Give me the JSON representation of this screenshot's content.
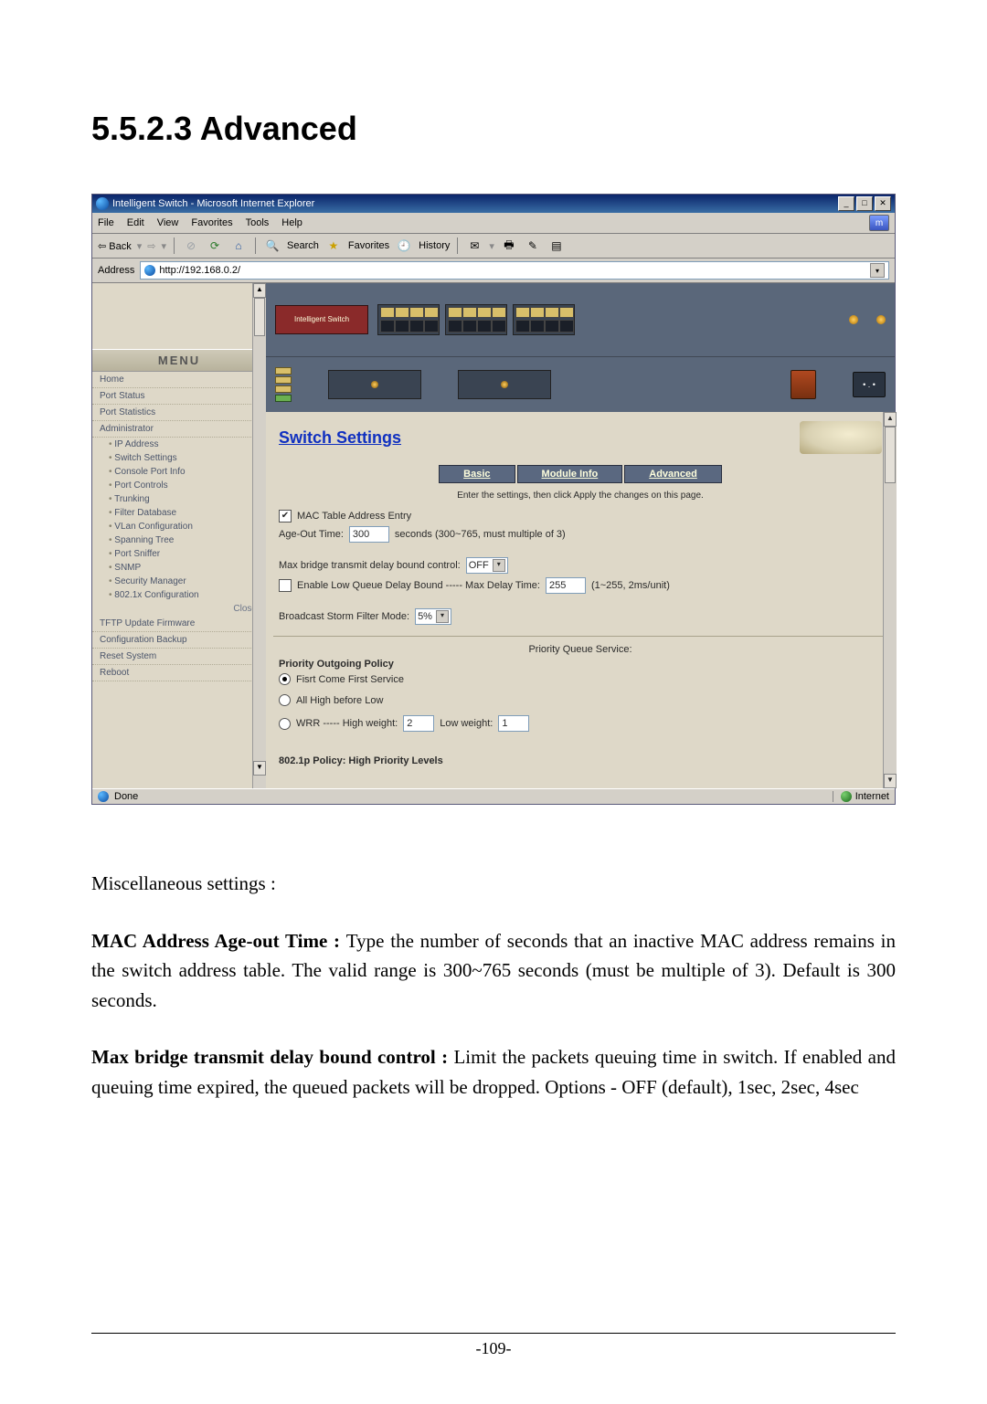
{
  "doc": {
    "section_heading": "5.5.2.3 Advanced",
    "misc_heading": "Miscellaneous settings :",
    "para1_lead": "MAC Address Age-out Time : ",
    "para1_rest": "Type the number of seconds that an inactive MAC address remains in the switch address table. The valid range is 300~765 seconds (must be multiple of 3). Default is 300 seconds.",
    "para2_lead": "Max bridge transmit delay bound control : ",
    "para2_rest": "Limit the packets queuing time in switch. If enabled and queuing time expired, the queued packets will be dropped. Options - OFF (default), 1sec, 2sec, 4sec",
    "page_number": "-109-"
  },
  "browser": {
    "window_title": "Intelligent Switch - Microsoft Internet Explorer",
    "menubar": {
      "file": "File",
      "edit": "Edit",
      "view": "View",
      "favorites": "Favorites",
      "tools": "Tools",
      "help": "Help"
    },
    "toolbar": {
      "back": "Back",
      "search": "Search",
      "favorites": "Favorites",
      "history": "History"
    },
    "address_label": "Address",
    "address_value": "http://192.168.0.2/",
    "status_done": "Done",
    "status_zone": "Internet"
  },
  "sidebar": {
    "menu_label": "MENU",
    "items_top": [
      "Home",
      "Port Status",
      "Port Statistics",
      "Administrator"
    ],
    "admin_sub": [
      "IP Address",
      "Switch Settings",
      "Console Port Info",
      "Port Controls",
      "Trunking",
      "Filter Database",
      "VLan Configuration",
      "Spanning Tree",
      "Port Sniffer",
      "SNMP",
      "Security Manager",
      "802.1x Configuration"
    ],
    "close": "Close",
    "items_bottom": [
      "TFTP Update Firmware",
      "Configuration Backup",
      "Reset System",
      "Reboot"
    ]
  },
  "main": {
    "page_title": "Switch Settings",
    "tabs": [
      "Basic",
      "Module Info",
      "Advanced"
    ],
    "instruction": "Enter the settings, then click Apply the changes on this page.",
    "mac_entry_label": "MAC Table Address Entry",
    "ageout_label": "Age-Out Time:",
    "ageout_value": "300",
    "ageout_suffix": "seconds (300~765, must multiple of 3)",
    "bridge_label": "Max bridge transmit delay bound control:",
    "bridge_value": "OFF",
    "lowq_label": "Enable Low Queue Delay Bound ----- Max Delay Time:",
    "lowq_value": "255",
    "lowq_suffix": "(1~255, 2ms/unit)",
    "storm_label": "Broadcast Storm Filter Mode:",
    "storm_value": "5%",
    "priority_header": "Priority Queue Service:",
    "priority_policy": "Priority Outgoing Policy",
    "radio1": "Fisrt Come First Service",
    "radio2": "All High before Low",
    "radio3_a": "WRR ----- High weight:",
    "radio3_hval": "2",
    "radio3_b": "Low weight:",
    "radio3_lval": "1",
    "policy_1p": "802.1p Policy: High Priority Levels"
  }
}
